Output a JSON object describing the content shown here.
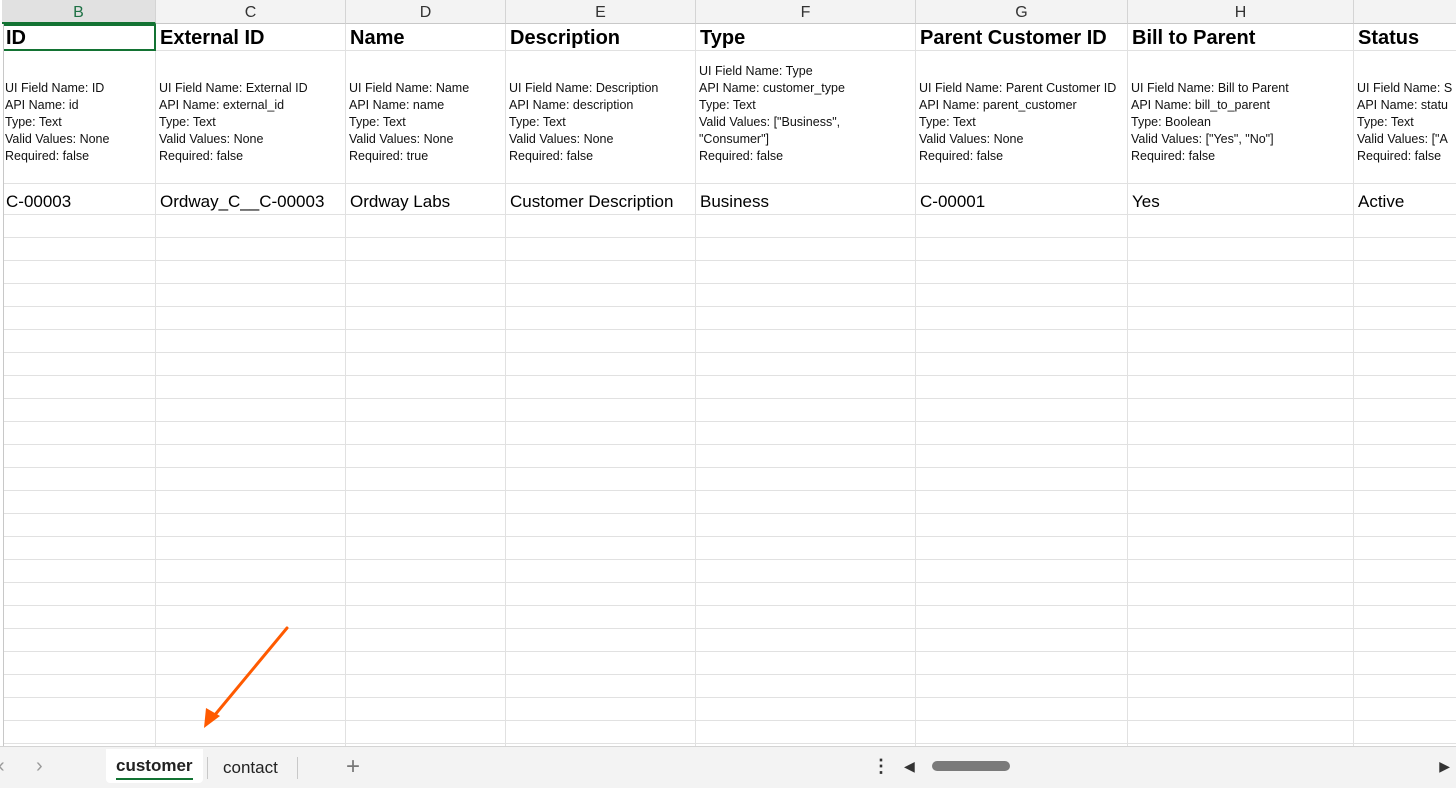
{
  "columns": [
    {
      "letter": "B",
      "title": "ID",
      "meta": [
        "UI Field Name: ID",
        "API Name: id",
        "Type: Text",
        "Valid Values: None",
        "Required: false"
      ],
      "value": "C-00003"
    },
    {
      "letter": "C",
      "title": "External ID",
      "meta": [
        "UI Field Name: External ID",
        "API Name: external_id",
        "Type: Text",
        "Valid Values: None",
        "Required: false"
      ],
      "value": "Ordway_C__C-00003"
    },
    {
      "letter": "D",
      "title": "Name",
      "meta": [
        "UI Field Name: Name",
        "API Name: name",
        "Type: Text",
        "Valid Values: None",
        "Required: true"
      ],
      "value": "Ordway Labs"
    },
    {
      "letter": "E",
      "title": "Description",
      "meta": [
        "UI Field Name: Description",
        "API Name: description",
        "Type: Text",
        "Valid Values: None",
        "Required: false"
      ],
      "value": "Customer Description"
    },
    {
      "letter": "F",
      "title": "Type",
      "meta": [
        "UI Field Name: Type",
        "API Name: customer_type",
        "Type: Text",
        "Valid Values: [\"Business\",",
        "\"Consumer\"]",
        "Required: false"
      ],
      "value": "Business"
    },
    {
      "letter": "G",
      "title": "Parent Customer ID",
      "meta": [
        "UI Field Name: Parent Customer ID",
        "API Name: parent_customer",
        "Type: Text",
        "Valid Values: None",
        "Required: false"
      ],
      "value": "C-00001"
    },
    {
      "letter": "H",
      "title": "Bill to Parent",
      "meta": [
        "UI Field Name: Bill to Parent",
        "API Name: bill_to_parent",
        "Type: Boolean",
        "Valid Values: [\"Yes\", \"No\"]",
        "Required: false"
      ],
      "value": "Yes"
    },
    {
      "letter": "",
      "title": "Status",
      "meta": [
        "UI Field Name: S",
        "API Name: statu",
        "Type: Text",
        "Valid Values: [\"A",
        "Required: false"
      ],
      "value": "Active"
    }
  ],
  "selected_column": "B",
  "sheet_tabs": {
    "active": "customer",
    "other": "contact"
  },
  "icons": {
    "prev_sheet": "chevron-left-icon",
    "next_sheet": "chevron-right-icon",
    "add_sheet": "plus-icon",
    "more": "vertical-ellipsis-icon",
    "scroll_left": "triangle-left-icon",
    "scroll_right": "triangle-right-icon"
  },
  "colors": {
    "selection": "#137333",
    "annotation_arrow": "#ff5a00"
  }
}
